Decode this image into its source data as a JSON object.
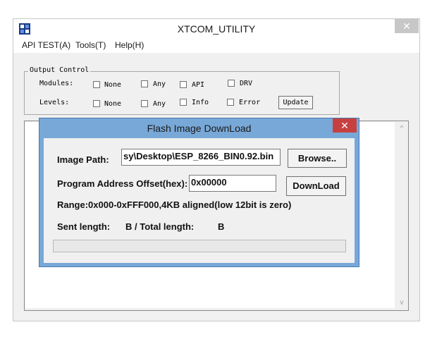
{
  "app": {
    "title": "XTCOM_UTILITY",
    "close_glyph": "✕"
  },
  "menu": [
    {
      "label": "API TEST(A)"
    },
    {
      "label": "Tools(T)"
    },
    {
      "label": "Help(H)"
    }
  ],
  "output_control": {
    "legend": "Output Control",
    "modules_label": "Modules:",
    "levels_label": "Levels:",
    "modules": [
      "None",
      "Any",
      "API",
      "DRV"
    ],
    "levels": [
      "None",
      "Any",
      "Info",
      "Error"
    ],
    "update_label": "Update"
  },
  "scrollbar": {
    "up_glyph": "^",
    "down_glyph": "v"
  },
  "dialog": {
    "title": "Flash Image DownLoad",
    "close_glyph": "✕",
    "image_path_label": "Image Path:",
    "image_path_value": "sy\\Desktop\\ESP_8266_BIN0.92.bin",
    "browse_label": "Browse..",
    "offset_label": "Program Address Offset(hex):",
    "offset_value": "0x00000",
    "download_label": "DownLoad",
    "range_text": "Range:0x000-0xFFF000,4KB aligned(low 12bit is zero)",
    "sent_length_label": "Sent length:",
    "sent_unit": "B / Total length:",
    "total_unit": "B",
    "progress": 0
  },
  "colors": {
    "dialog_frame": "#78a8d8",
    "dialog_close": "#c74040",
    "window_bg": "#f0f0f0"
  }
}
